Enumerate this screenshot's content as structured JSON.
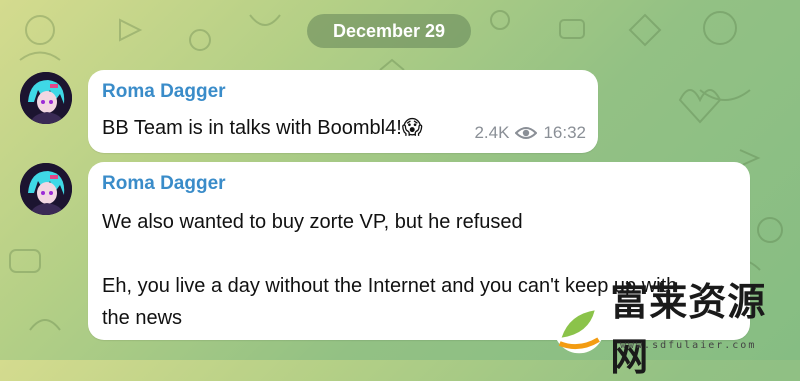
{
  "date_divider": "December 29",
  "messages": [
    {
      "sender": "Roma Dagger",
      "text": "BB Team is in talks with Boombl4!",
      "emoji": "😱",
      "views": "2.4K",
      "time": "16:32"
    },
    {
      "sender": "Roma Dagger",
      "lines": [
        "We also wanted to buy zorte VP, but he refused",
        "",
        "Eh, you live a day without the Internet and you can't keep up with",
        "the news"
      ]
    }
  ],
  "watermark": {
    "brand": "富莱资源网",
    "url": "www.sdfulaier.com"
  },
  "colors": {
    "sender": "#3a8cc9",
    "bubble": "#ffffff",
    "pill": "#628458"
  },
  "icons": [
    "eye-icon",
    "avatar-image",
    "leaf-logo-icon"
  ]
}
